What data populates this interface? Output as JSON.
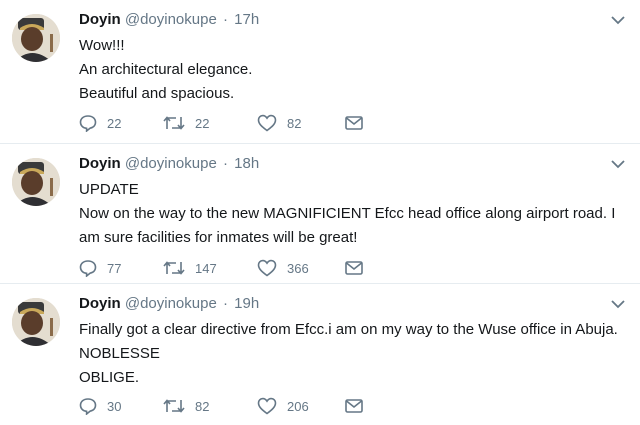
{
  "tweets": [
    {
      "name": "Doyin",
      "handle": "@doyinokupe",
      "separator": "·",
      "time": "17h",
      "lines": [
        "Wow!!!",
        "An architectural elegance.",
        "Beautiful and spacious."
      ],
      "replies": "22",
      "retweets": "22",
      "likes": "82"
    },
    {
      "name": "Doyin",
      "handle": "@doyinokupe",
      "separator": "·",
      "time": "18h",
      "lines": [
        "UPDATE",
        "Now on the way to the new MAGNIFICIENT Efcc head office along airport road. I am sure facilities for inmates will be great!"
      ],
      "replies": "77",
      "retweets": "147",
      "likes": "366"
    },
    {
      "name": "Doyin",
      "handle": "@doyinokupe",
      "separator": "·",
      "time": "19h",
      "lines": [
        "Finally got a clear directive from Efcc.i am on my way to the Wuse office in Abuja.",
        "NOBLESSE",
        "OBLIGE."
      ],
      "replies": "30",
      "retweets": "82",
      "likes": "206"
    }
  ],
  "icons": {
    "reply": "reply-icon",
    "retweet": "retweet-icon",
    "like": "heart-icon",
    "message": "envelope-icon",
    "caret": "chevron-down-icon"
  },
  "colors": {
    "text": "#14171a",
    "secondary": "#657786",
    "divider": "#e6ecf0"
  }
}
